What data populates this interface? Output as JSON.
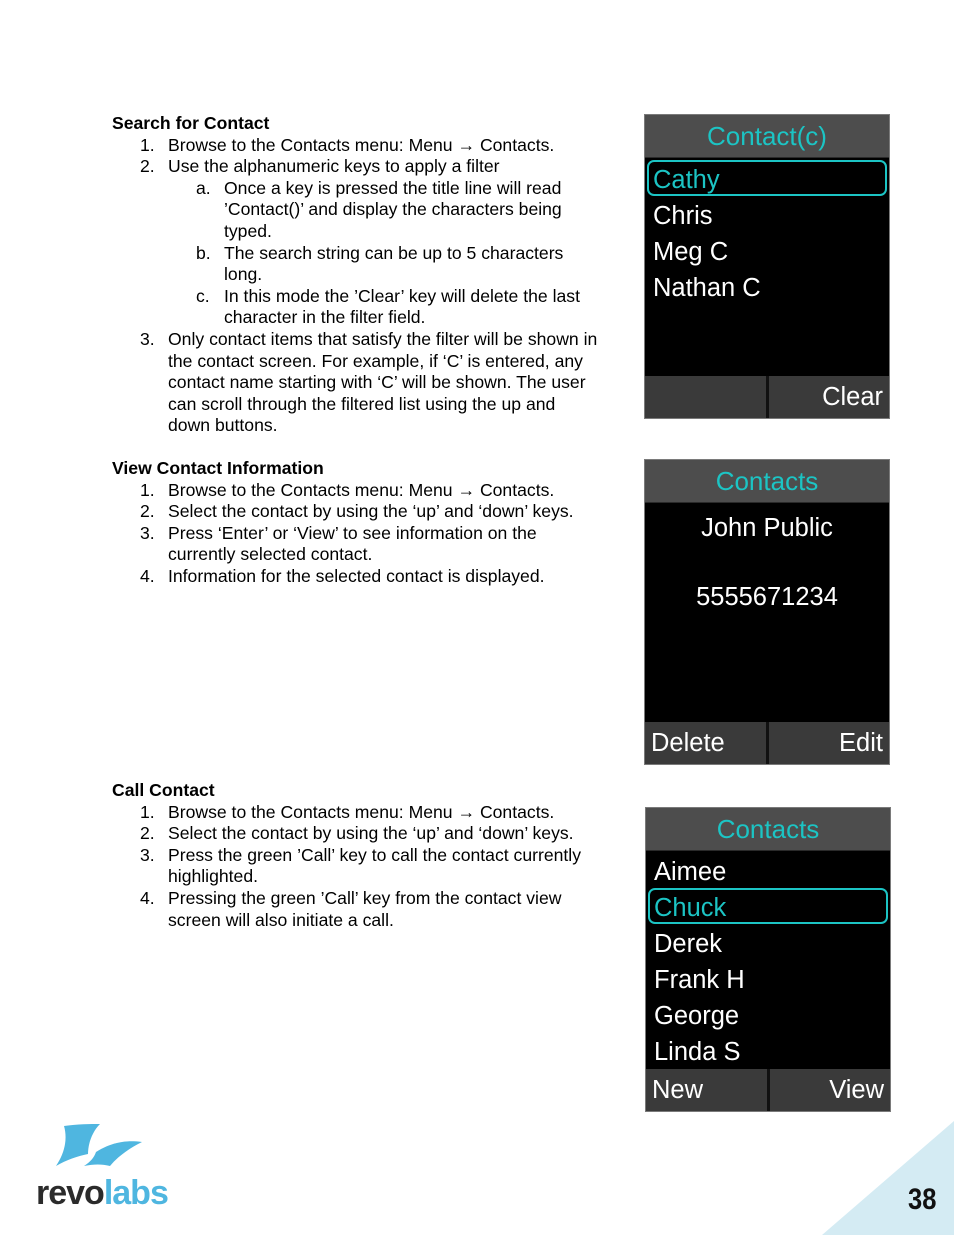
{
  "sections": {
    "search": {
      "heading": "Search for Contact",
      "steps": [
        {
          "num": "1.",
          "text": "Browse to the Contacts menu: Menu → Contacts."
        },
        {
          "num": "2.",
          "text": "Use the alphanumeric keys to apply a filter",
          "substeps": [
            {
              "num": "a.",
              "text": "Once a key is pressed the title line will read ’Contact()’ and display the characters being typed."
            },
            {
              "num": "b.",
              "text": "The search string can be up to 5 characters long."
            },
            {
              "num": "c.",
              "text": "In this mode the ’Clear’ key will delete the last character in the filter field."
            }
          ]
        },
        {
          "num": "3.",
          "text": "Only contact items that satisfy the filter will be shown in the contact screen.  For example, if ‘C’ is entered, any contact name starting with ‘C’ will be shown. The user can scroll through the filtered list using the up and down buttons."
        }
      ]
    },
    "view": {
      "heading": "View Contact Information",
      "steps": [
        {
          "num": "1.",
          "text": "Browse to the Contacts menu: Menu → Contacts."
        },
        {
          "num": "2.",
          "text": "Select the contact by using the ‘up’ and ‘down’ keys."
        },
        {
          "num": "3.",
          "text": "Press ‘Enter’ or ‘View’ to see information on the currently selected contact."
        },
        {
          "num": "4.",
          "text": "Information for the selected contact is displayed."
        }
      ]
    },
    "call": {
      "heading": "Call Contact",
      "steps": [
        {
          "num": "1.",
          "text": "Browse to the Contacts menu: Menu → Contacts."
        },
        {
          "num": "2.",
          "text": "Select the contact by using the ‘up’ and ‘down’ keys."
        },
        {
          "num": "3.",
          "text": "Press the green ’Call’ key to call the contact currently highlighted."
        },
        {
          "num": "4.",
          "text": "Pressing the green ’Call’ key from the contact view screen will also initiate a call."
        }
      ]
    }
  },
  "screens": {
    "filter": {
      "title": "Contact(c)",
      "contacts": [
        "Cathy",
        "Chris",
        "Meg C",
        "Nathan C"
      ],
      "selected_index": 0,
      "softkey_left": "",
      "softkey_right": "Clear"
    },
    "detail": {
      "title": "Contacts",
      "name": "John Public",
      "number": "5555671234",
      "softkey_left": "Delete",
      "softkey_right": "Edit"
    },
    "list": {
      "title": "Contacts",
      "contacts": [
        "Aimee",
        "Chuck",
        "Derek",
        "Frank H",
        "George",
        "Linda S"
      ],
      "selected_index": 1,
      "softkey_left": "New",
      "softkey_right": "View"
    }
  },
  "colors": {
    "accent": "#1cc4c4",
    "title_bar": "#4d4d4d",
    "softkey_bg": "#3a3a3a",
    "logo_blue": "#4fb6e0",
    "corner_blue": "#d4ebf3"
  },
  "footer": {
    "logo_text_dark": "revo",
    "logo_text_light": "labs",
    "page_number": "38"
  }
}
